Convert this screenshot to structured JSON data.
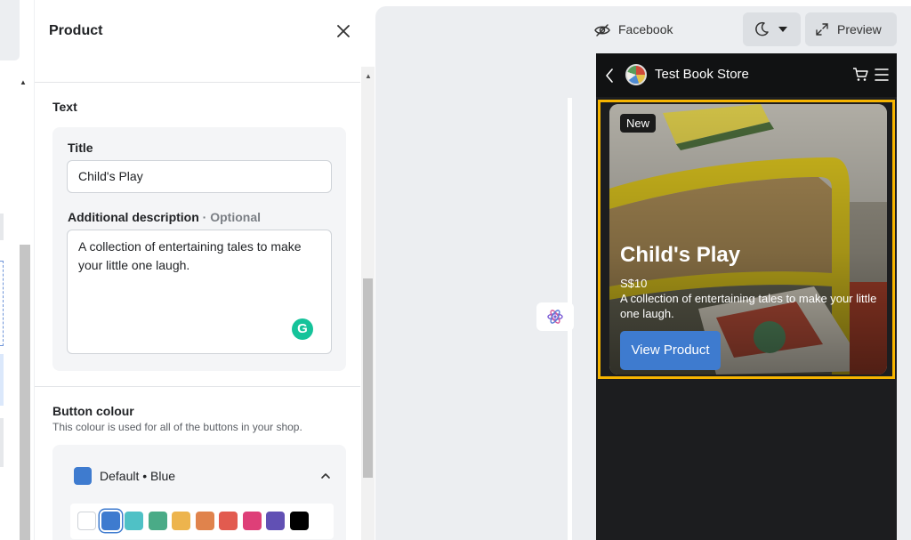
{
  "panel": {
    "title": "Product",
    "text_section": {
      "label": "Text",
      "title_field": {
        "label": "Title",
        "value": "Child's Play"
      },
      "description_field": {
        "label": "Additional description",
        "optional": "· Optional",
        "value": "A collection of entertaining tales to make your little one laugh."
      }
    },
    "button_colour": {
      "label": "Button colour",
      "helper": "This colour is used for all of the buttons in your shop.",
      "selected": "Default • Blue",
      "selected_hex": "#3e7bcf",
      "swatches": [
        "#ffffff",
        "#3e7bcf",
        "#4fc1c6",
        "#4aab87",
        "#edb44d",
        "#e0834c",
        "#e25b4f",
        "#de3f78",
        "#6150b4",
        "#000000"
      ],
      "selected_index": 1
    }
  },
  "topbar": {
    "channel": "Facebook",
    "preview_label": "Preview"
  },
  "preview": {
    "store_name": "Test Book Store",
    "hero": {
      "badge": "New",
      "title": "Child's Play",
      "price": "S$10",
      "description": "A collection of entertaining tales to make your little one laugh.",
      "button": "View Product"
    }
  },
  "colors": {
    "accent_blue": "#3e7bcf",
    "selection_outline": "#f6b400",
    "phone_background": "#1c1d1f"
  }
}
